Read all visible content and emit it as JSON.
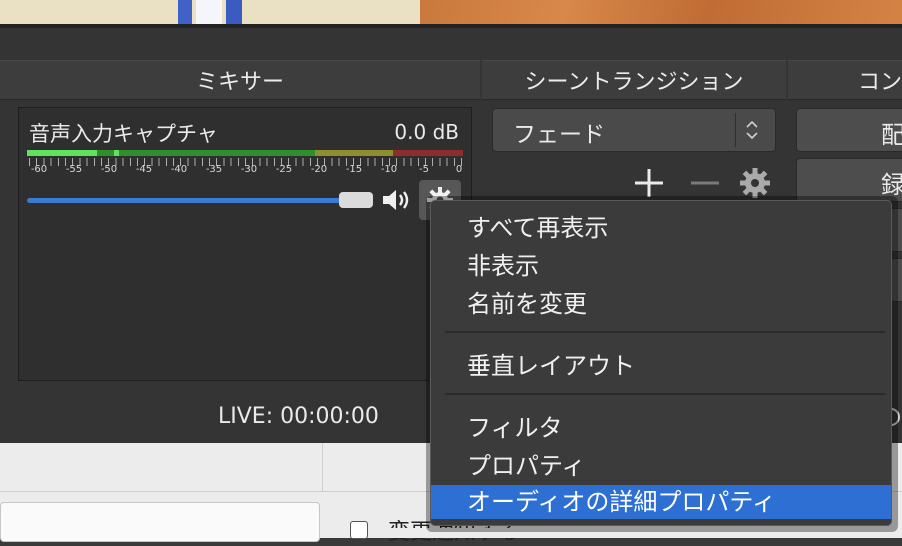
{
  "docks": {
    "mixer_title": "ミキサー",
    "transition_title": "シーントランジション",
    "controls_title": "コン"
  },
  "mixer": {
    "source_name": "音声入力キャプチャ",
    "level": "0.0 dB",
    "ticks": [
      "-60",
      "-55",
      "-50",
      "-45",
      "-40",
      "-35",
      "-30",
      "-25",
      "-20",
      "-15",
      "-10",
      "-5",
      "0"
    ],
    "volume_fraction": 0.9
  },
  "status": {
    "live": "LIVE: 00:00:00"
  },
  "transition": {
    "selected": "フェード"
  },
  "controls": {
    "buttons": [
      "配",
      "録"
    ]
  },
  "context_menu": {
    "items": [
      "すべて再表示",
      "非表示",
      "名前を変更",
      "垂直レイアウト",
      "フィルタ",
      "プロパティ",
      "オーディオの詳細プロパティ"
    ],
    "selected_index": 6
  },
  "bottom": {
    "checkbox_label": "変更通知する"
  },
  "colors": {
    "menu_highlight": "#2d6fd3",
    "volume_slider": "#3a7bd5",
    "meter_green": "#5fe35f"
  }
}
